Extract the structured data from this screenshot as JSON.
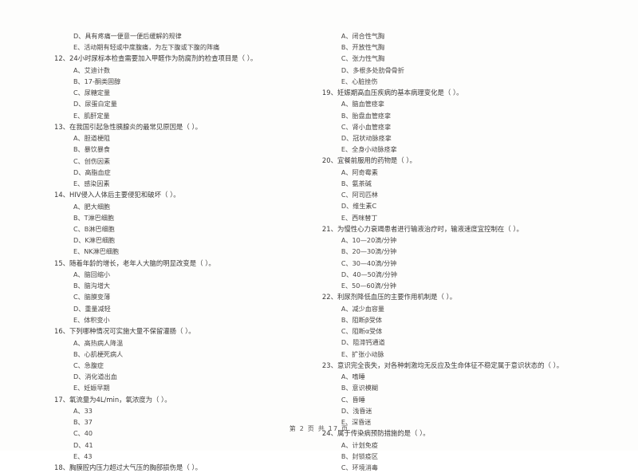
{
  "document": {
    "footer": "第 2 页 共 17 页"
  },
  "left_column": {
    "continued_options": [
      "D、具有疼痛一便意一便后缓解的规律",
      "E、活动期有轻或中度腹痛，为左下腹或下腹的阵痛"
    ],
    "questions": [
      {
        "number": "12",
        "stem": "12、24小时尿标本检查需要加入甲醛作为防腐剂的检查项目是（      ）。",
        "options": [
          "A、艾迪计数",
          "B、17-酮类固醇",
          "C、尿糖定量",
          "D、尿蛋白定量",
          "E、肌酐定量"
        ]
      },
      {
        "number": "13",
        "stem": "13、在我国引起急性胰腺炎的最常见原因是（      ）。",
        "options": [
          "A、胆道梗阻",
          "B、暴饮暴食",
          "C、创伤因素",
          "D、高脂血症",
          "E、感染因素"
        ]
      },
      {
        "number": "14",
        "stem": "14、HIV侵入人体后主要侵犯和破坏（      ）。",
        "options": [
          "A、肥大细胞",
          "B、T淋巴细胞",
          "C、B淋巴细胞",
          "D、K淋巴细胞",
          "E、NK淋巴细胞"
        ]
      },
      {
        "number": "15",
        "stem": "15、随着年龄的增长，老年人大脑的明显改变是（      ）。",
        "options": [
          "A、脑回缩小",
          "B、脑沟增大",
          "C、脑膜变薄",
          "D、重量减轻",
          "E、体积变小"
        ]
      },
      {
        "number": "16",
        "stem": "16、下列哪种情况可实施大量不保留灌肠（      ）。",
        "options": [
          "A、高热病人降温",
          "B、心肌梗死病人",
          "C、急腹症",
          "D、消化道出血",
          "E、妊娠早期"
        ]
      },
      {
        "number": "17",
        "stem": "17、氧流量为4L/min，氧浓度为（      ）。",
        "options": [
          "A、33",
          "B、37",
          "C、40",
          "D、41",
          "E、43"
        ]
      },
      {
        "number": "18",
        "stem": "18、胸膜腔内压力超过大气压的胸部损伤是（      ）。",
        "options": []
      }
    ]
  },
  "right_column": {
    "continued_options": [
      "A、闭合性气胸",
      "B、开放性气胸",
      "C、张力性气胸",
      "D、多根多处肋骨骨折",
      "E、心脏挫伤"
    ],
    "questions": [
      {
        "number": "19",
        "stem": "19、妊娠期高血压疾病的基本病理变化是（      ）。",
        "options": [
          "A、脑血管痉挛",
          "B、胎盘血管痉挛",
          "C、肾小血管痉挛",
          "D、冠状动脉痉挛",
          "E、全身小动脉痉挛"
        ]
      },
      {
        "number": "20",
        "stem": "20、宜餐前服用的药物是（      ）。",
        "options": [
          "A、阿奇霉素",
          "B、氨茶碱",
          "C、阿司匹林",
          "D、维生素C",
          "E、西咪替丁"
        ]
      },
      {
        "number": "21",
        "stem": "21、为慢性心力衰竭患者进行输液治疗时，输液速度宜控制在（      ）。",
        "options": [
          "A、10—20滴/分钟",
          "B、20—30滴/分钟",
          "C、30—40滴/分钟",
          "D、40—50滴/分钟",
          "E、50—60滴/分钟"
        ]
      },
      {
        "number": "22",
        "stem": "22、利尿剂降低血压的主要作用机制是（      ）。",
        "options": [
          "A、减少血容量",
          "B、阻断β受体",
          "C、阻断α受体",
          "D、阻滞钙通道",
          "E、扩张小动脉"
        ]
      },
      {
        "number": "23",
        "stem": "23、意识完全丧失，对各种刺激均无反应及生命体征不稳定属于意识状态的（      ）。",
        "options": [
          "A、嗜睡",
          "B、意识模糊",
          "C、昏睡",
          "D、浅昏迷",
          "E、深昏迷"
        ]
      },
      {
        "number": "24",
        "stem": "24、属于传染病预防措施的是（      ）。",
        "options": [
          "A、计划免疫",
          "B、封锁疫区",
          "C、环境消毒"
        ]
      }
    ]
  }
}
